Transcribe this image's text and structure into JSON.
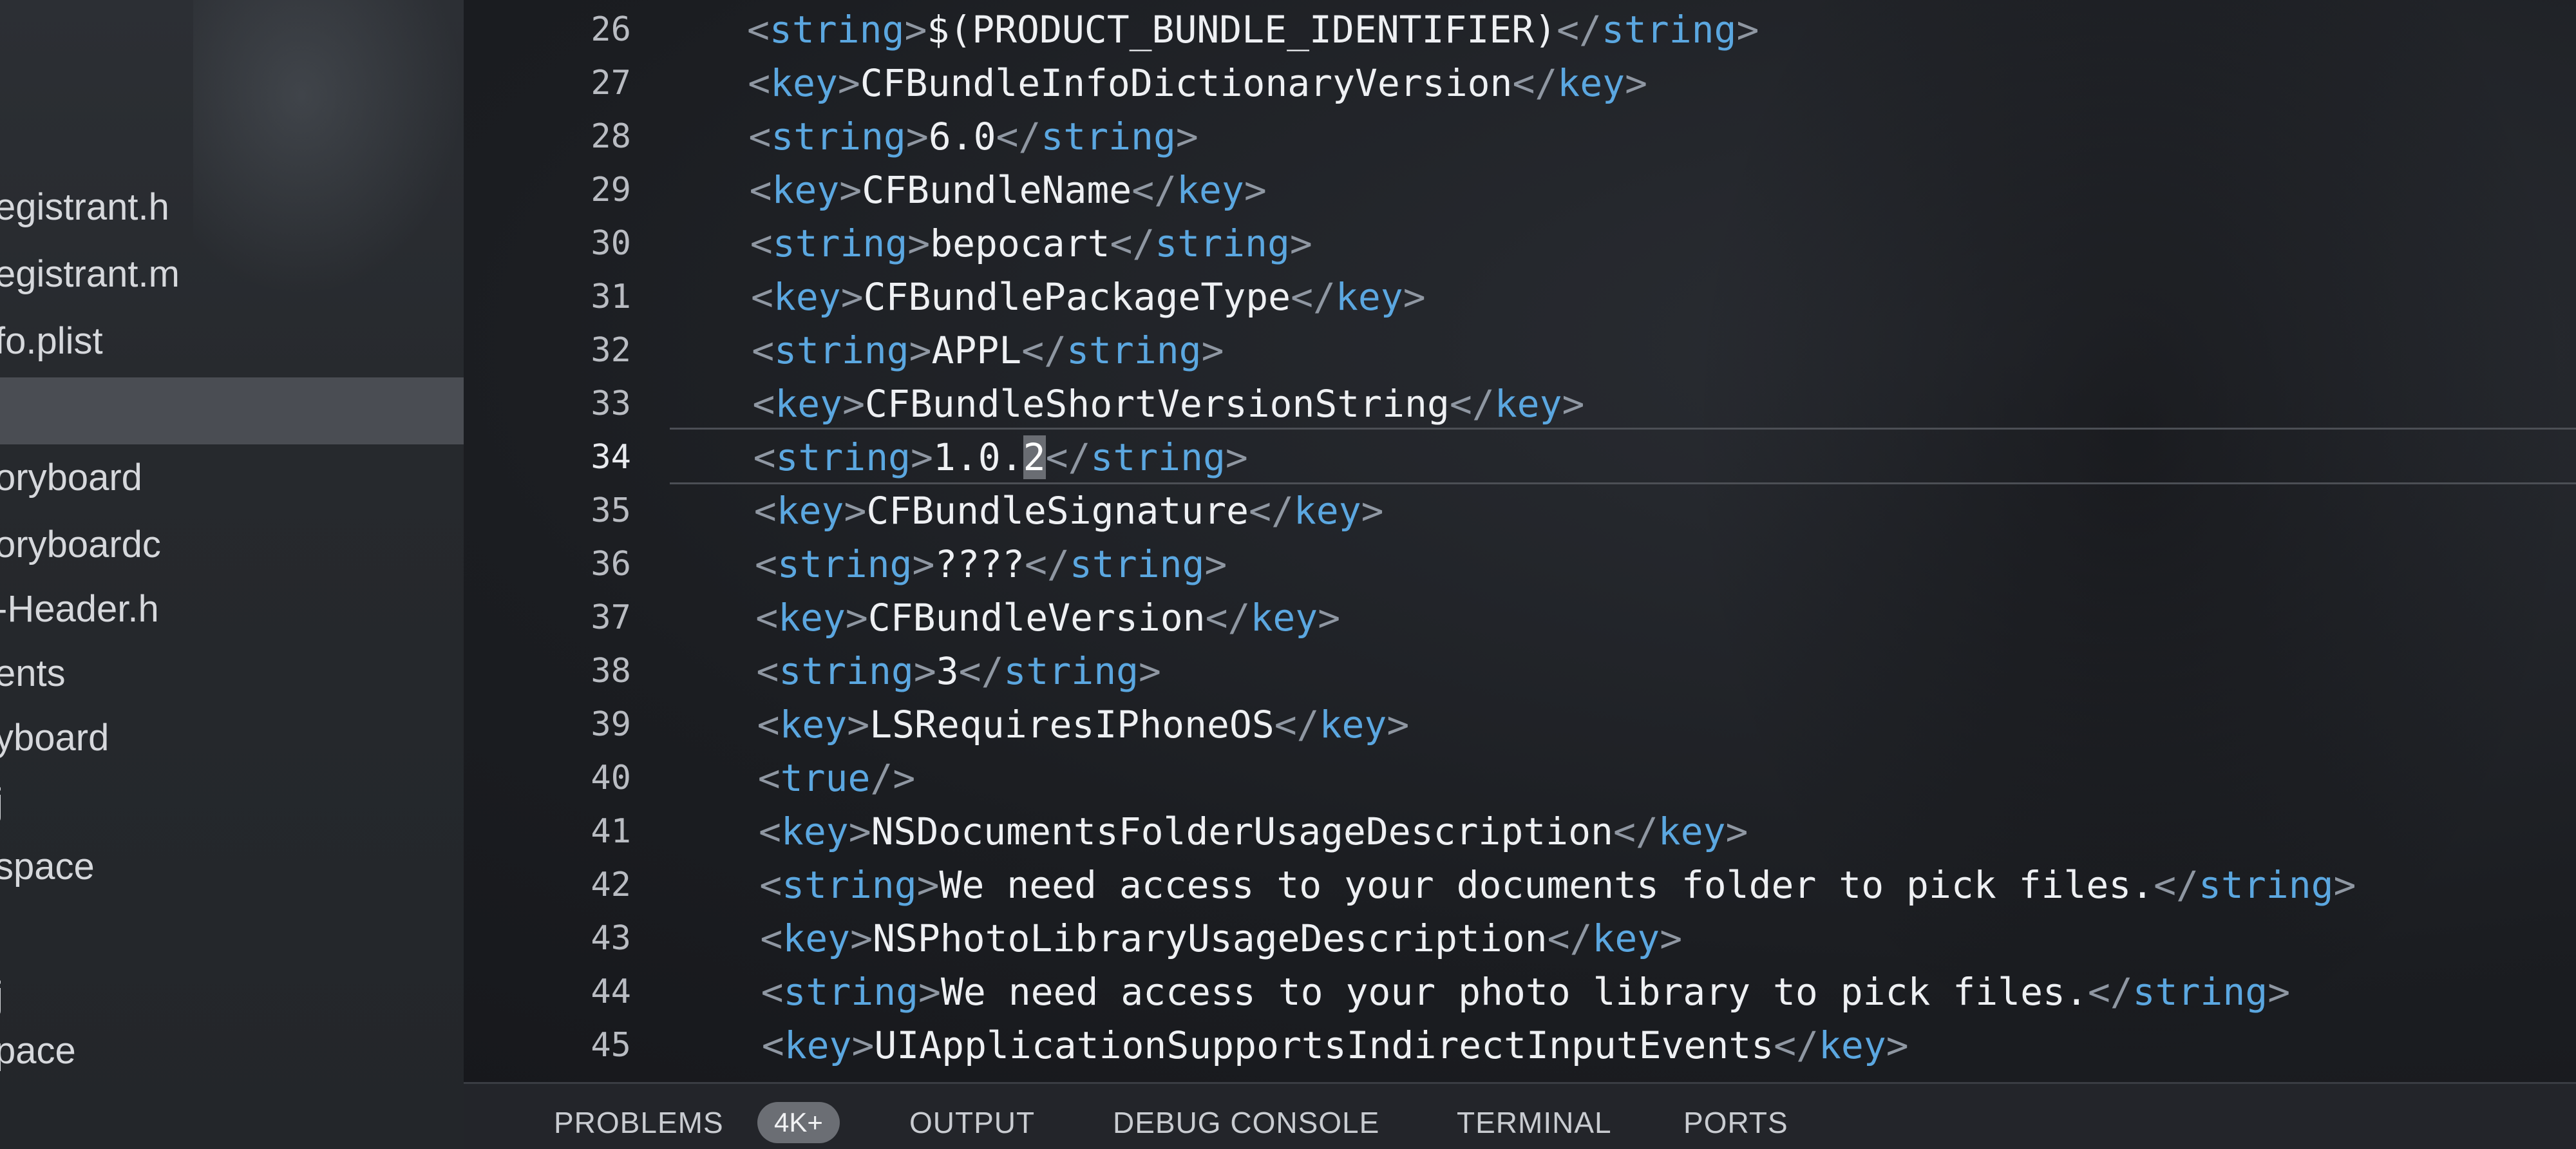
{
  "sidebar": {
    "items": [
      {
        "label": "egistrant.h"
      },
      {
        "label": "egistrant.m"
      },
      {
        "label": "fo.plist"
      },
      {
        "label": ""
      },
      {
        "label": "oryboard"
      },
      {
        "label": "oryboardc"
      },
      {
        "label": "-Header.h"
      },
      {
        "label": "ents"
      },
      {
        "label": "yboard"
      },
      {
        "label": "j"
      },
      {
        "label": "space"
      },
      {
        "label": ""
      },
      {
        "label": "j"
      },
      {
        "label": "pace"
      }
    ]
  },
  "editor": {
    "lines": [
      {
        "num": "26",
        "indent": "",
        "tag": "string",
        "text": "$(PRODUCT_BUNDLE_IDENTIFIER)",
        "type": "pair"
      },
      {
        "num": "27",
        "indent": "",
        "tag": "key",
        "text": "CFBundleInfoDictionaryVersion",
        "type": "pair"
      },
      {
        "num": "28",
        "indent": "",
        "tag": "string",
        "text": "6.0",
        "type": "pair"
      },
      {
        "num": "29",
        "indent": "",
        "tag": "key",
        "text": "CFBundleName",
        "type": "pair"
      },
      {
        "num": "30",
        "indent": "",
        "tag": "string",
        "text": "bepocart",
        "type": "pair"
      },
      {
        "num": "31",
        "indent": "",
        "tag": "key",
        "text": "CFBundlePackageType",
        "type": "pair"
      },
      {
        "num": "32",
        "indent": "",
        "tag": "string",
        "text": "APPL",
        "type": "pair"
      },
      {
        "num": "33",
        "indent": "",
        "tag": "key",
        "text": "CFBundleShortVersionString",
        "type": "pair"
      },
      {
        "num": "34",
        "indent": "",
        "tag": "string",
        "text": "1.0.2",
        "type": "pair",
        "current": true,
        "selected": "2"
      },
      {
        "num": "35",
        "indent": "",
        "tag": "key",
        "text": "CFBundleSignature",
        "type": "pair"
      },
      {
        "num": "36",
        "indent": "",
        "tag": "string",
        "text": "????",
        "type": "pair"
      },
      {
        "num": "37",
        "indent": "",
        "tag": "key",
        "text": "CFBundleVersion",
        "type": "pair"
      },
      {
        "num": "38",
        "indent": "",
        "tag": "string",
        "text": "3",
        "type": "pair"
      },
      {
        "num": "39",
        "indent": "",
        "tag": "key",
        "text": "LSRequiresIPhoneOS",
        "type": "pair"
      },
      {
        "num": "40",
        "indent": "",
        "tag": "true",
        "text": "",
        "type": "selfclosing"
      },
      {
        "num": "41",
        "indent": "",
        "tag": "key",
        "text": "NSDocumentsFolderUsageDescription",
        "type": "pair"
      },
      {
        "num": "42",
        "indent": "",
        "tag": "string",
        "text": "We need access to your documents folder to pick files.",
        "type": "pair"
      },
      {
        "num": "43",
        "indent": "",
        "tag": "key",
        "text": "NSPhotoLibraryUsageDescription",
        "type": "pair"
      },
      {
        "num": "44",
        "indent": "",
        "tag": "string",
        "text": "We need access to your photo library to pick files.",
        "type": "pair"
      },
      {
        "num": "45",
        "indent": "",
        "tag": "key",
        "text": "UIApplicationSupportsIndirectInputEvents",
        "type": "pair"
      }
    ]
  },
  "panel": {
    "tabs": [
      {
        "label": "PROBLEMS"
      },
      {
        "label": "OUTPUT"
      },
      {
        "label": "DEBUG CONSOLE"
      },
      {
        "label": "TERMINAL"
      },
      {
        "label": "PORTS"
      }
    ],
    "problems_badge": "4K+"
  },
  "colors": {
    "tag": "#5ba7e0",
    "bracket": "#8f97a2",
    "text": "#eef0f3",
    "line_number": "#b9bcc2",
    "sidebar_selected": "#4a4d53",
    "badge": "#6b6e74"
  }
}
